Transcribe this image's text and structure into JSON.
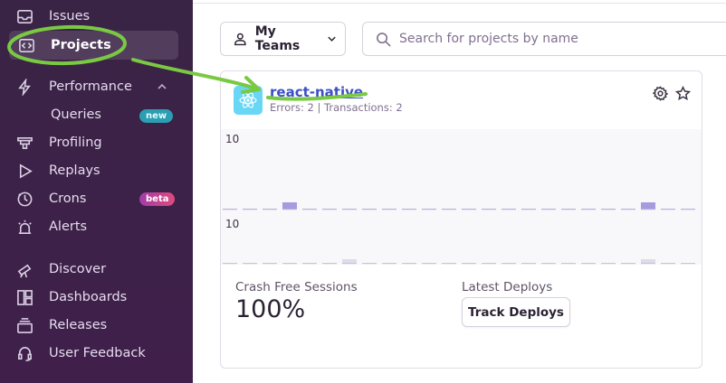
{
  "sidebar": {
    "items": [
      {
        "label": "Issues",
        "icon": "inbox-icon"
      },
      {
        "label": "Projects",
        "icon": "code-brackets-icon"
      },
      {
        "label": "Performance",
        "icon": "lightning-icon"
      },
      {
        "label": "Queries",
        "icon": ""
      },
      {
        "label": "Profiling",
        "icon": "profiling-icon"
      },
      {
        "label": "Replays",
        "icon": "play-icon"
      },
      {
        "label": "Crons",
        "icon": "clock-icon"
      },
      {
        "label": "Alerts",
        "icon": "siren-icon"
      },
      {
        "label": "Discover",
        "icon": "telescope-icon"
      },
      {
        "label": "Dashboards",
        "icon": "dashboard-icon"
      },
      {
        "label": "Releases",
        "icon": "stack-icon"
      },
      {
        "label": "User Feedback",
        "icon": "headset-icon"
      }
    ],
    "badges": {
      "queries": "new",
      "crons": "beta"
    }
  },
  "toolbar": {
    "teams_label": "My Teams",
    "search_placeholder": "Search for projects by name"
  },
  "project": {
    "name": "react-native",
    "meta": "Errors: 2 | Transactions: 2",
    "chart_top_label": "10",
    "chart_bottom_label": "10",
    "errors_bars": [
      0,
      0,
      0,
      1,
      0,
      0,
      0,
      0,
      0,
      0,
      0,
      0,
      0,
      0,
      0,
      0,
      0,
      0,
      0,
      0,
      0,
      1,
      0,
      0
    ],
    "transactions_bars": [
      0,
      0,
      0,
      0,
      0,
      0,
      1,
      0,
      0,
      0,
      0,
      0,
      0,
      0,
      0,
      0,
      0,
      0,
      0,
      0,
      0,
      1,
      0,
      0
    ],
    "crash_free_label": "Crash Free Sessions",
    "crash_free_value": "100%",
    "deploys_label": "Latest Deploys",
    "track_deploys_label": "Track Deploys"
  },
  "colors": {
    "sidebar_bg": "#3d2148",
    "accent_link": "#3b4fc6",
    "bar_purple": "#a79be0",
    "annotation_green": "#7ac943"
  }
}
